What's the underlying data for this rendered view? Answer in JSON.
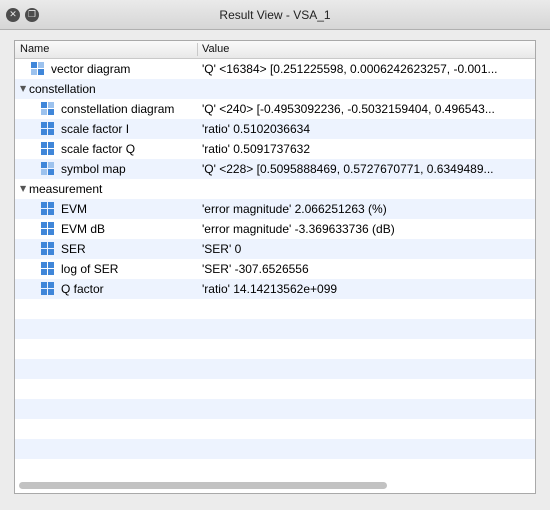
{
  "window": {
    "title": "Result View - VSA_1"
  },
  "columns": {
    "name": "Name",
    "value": "Value"
  },
  "rows": [
    {
      "kind": "item",
      "level": 0,
      "icon": "matrix-icon",
      "name": "vector diagram",
      "value": "'Q' <16384> [0.251225598, 0.0006242623257, -0.001..."
    },
    {
      "kind": "group",
      "name": "constellation"
    },
    {
      "kind": "item",
      "level": 1,
      "icon": "matrix-icon",
      "name": "constellation diagram",
      "value": "'Q' <240> [-0.4953092236, -0.5032159404, 0.496543..."
    },
    {
      "kind": "item",
      "level": 1,
      "icon": "scalar-icon",
      "name": "scale factor I",
      "value": "'ratio' 0.5102036634"
    },
    {
      "kind": "item",
      "level": 1,
      "icon": "scalar-icon",
      "name": "scale factor Q",
      "value": "'ratio' 0.5091737632"
    },
    {
      "kind": "item",
      "level": 1,
      "icon": "matrix-icon",
      "name": "symbol map",
      "value": "'Q' <228> [0.5095888469, 0.5727670771, 0.6349489..."
    },
    {
      "kind": "group",
      "name": "measurement"
    },
    {
      "kind": "item",
      "level": 1,
      "icon": "scalar-icon",
      "name": "EVM",
      "value": "'error magnitude' 2.066251263 (%)"
    },
    {
      "kind": "item",
      "level": 1,
      "icon": "scalar-icon",
      "name": "EVM dB",
      "value": "'error magnitude' -3.369633736 (dB)"
    },
    {
      "kind": "item",
      "level": 1,
      "icon": "scalar-icon",
      "name": "SER",
      "value": "'SER' 0"
    },
    {
      "kind": "item",
      "level": 1,
      "icon": "scalar-icon",
      "name": "log of SER",
      "value": "'SER' -307.6526556"
    },
    {
      "kind": "item",
      "level": 1,
      "icon": "scalar-icon",
      "name": "Q factor",
      "value": "'ratio' 14.14213562e+099"
    }
  ]
}
